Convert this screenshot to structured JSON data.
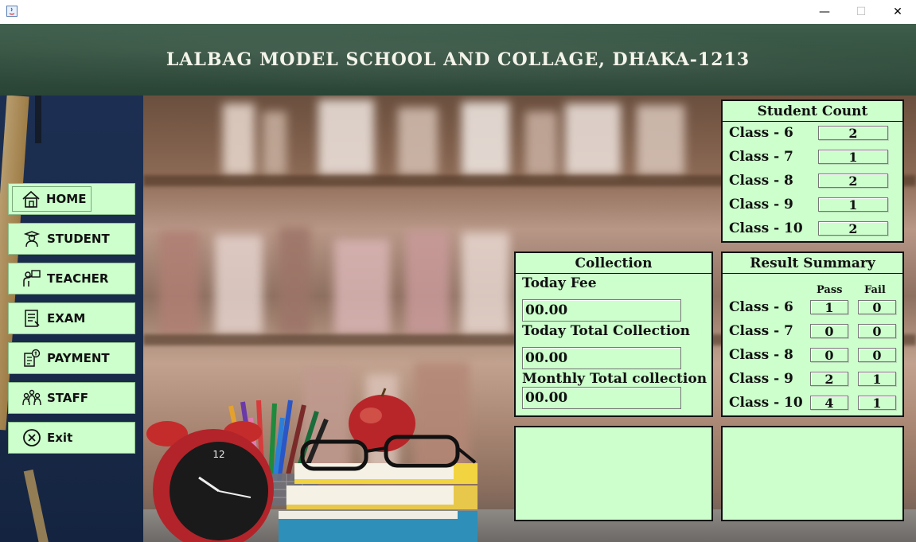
{
  "window": {
    "min_glyph": "—",
    "max_glyph": "☐",
    "close_glyph": "✕"
  },
  "header": {
    "title": "LALBAG MODEL SCHOOL AND COLLAGE, DHAKA-1213"
  },
  "sidebar": {
    "items": [
      {
        "label": "HOME",
        "icon": "home-icon"
      },
      {
        "label": "STUDENT",
        "icon": "student-icon"
      },
      {
        "label": "TEACHER",
        "icon": "teacher-icon"
      },
      {
        "label": "EXAM",
        "icon": "exam-icon"
      },
      {
        "label": "PAYMENT",
        "icon": "payment-icon"
      },
      {
        "label": "STAFF",
        "icon": "staff-icon"
      },
      {
        "label": "Exit",
        "icon": "exit-icon"
      }
    ]
  },
  "student_count": {
    "title": "Student Count",
    "rows": [
      {
        "label": "Class - 6",
        "value": "2"
      },
      {
        "label": "Class - 7",
        "value": "1"
      },
      {
        "label": "Class - 8",
        "value": "2"
      },
      {
        "label": "Class - 9",
        "value": "1"
      },
      {
        "label": "Class - 10",
        "value": "2"
      }
    ]
  },
  "collection": {
    "title": "Collection",
    "today_fee_label": "Today Fee",
    "today_fee_value": "00.00",
    "today_total_label": "Today Total Collection",
    "today_total_value": "00.00",
    "monthly_total_label": "Monthly Total collection",
    "monthly_total_value": "00.00"
  },
  "result_summary": {
    "title": "Result Summary",
    "pass_header": "Pass",
    "fail_header": "Fail",
    "rows": [
      {
        "label": "Class - 6",
        "pass": "1",
        "fail": "0"
      },
      {
        "label": "Class - 7",
        "pass": "0",
        "fail": "0"
      },
      {
        "label": "Class - 8",
        "pass": "0",
        "fail": "0"
      },
      {
        "label": "Class - 9",
        "pass": "2",
        "fail": "1"
      },
      {
        "label": "Class - 10",
        "pass": "4",
        "fail": "1"
      }
    ]
  },
  "colors": {
    "panel_bg": "#ccffcc",
    "header_bg": "#2f4c3b",
    "sidebar_bg": "#1c2f52"
  }
}
